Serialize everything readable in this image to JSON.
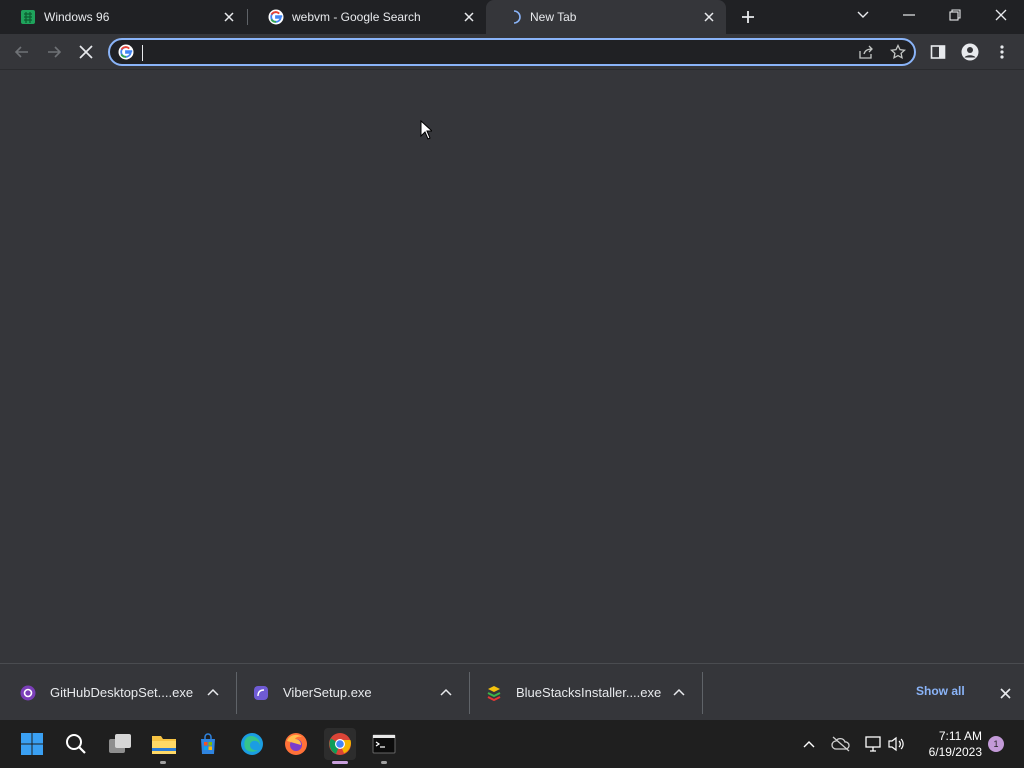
{
  "browser": {
    "tabs": [
      {
        "title": "Windows 96",
        "favicon": "windows96-icon",
        "active": false
      },
      {
        "title": "webvm - Google Search",
        "favicon": "google-icon",
        "active": false
      },
      {
        "title": "New Tab",
        "favicon": "loading-spinner-icon",
        "active": true
      }
    ],
    "omnibox": {
      "value": "",
      "placeholder": ""
    }
  },
  "downloads": {
    "items": [
      {
        "filename": "GitHubDesktopSet....exe",
        "icon": "github-icon"
      },
      {
        "filename": "ViberSetup.exe",
        "icon": "viber-icon"
      },
      {
        "filename": "BlueStacksInstaller....exe",
        "icon": "bluestacks-icon"
      }
    ],
    "show_all_label": "Show all"
  },
  "taskbar": {
    "apps": [
      "start-icon",
      "search-icon",
      "task-view-icon",
      "file-explorer-icon",
      "microsoft-store-icon",
      "edge-icon",
      "firefox-icon",
      "chrome-icon",
      "terminal-icon"
    ],
    "clock": {
      "time": "7:11 AM",
      "date": "6/19/2023"
    },
    "notification_count": "1"
  },
  "colors": {
    "accent": "#8ab4f8",
    "tab_strip": "#202124",
    "toolbar": "#35363a",
    "taskbar": "#1f1f1f"
  }
}
